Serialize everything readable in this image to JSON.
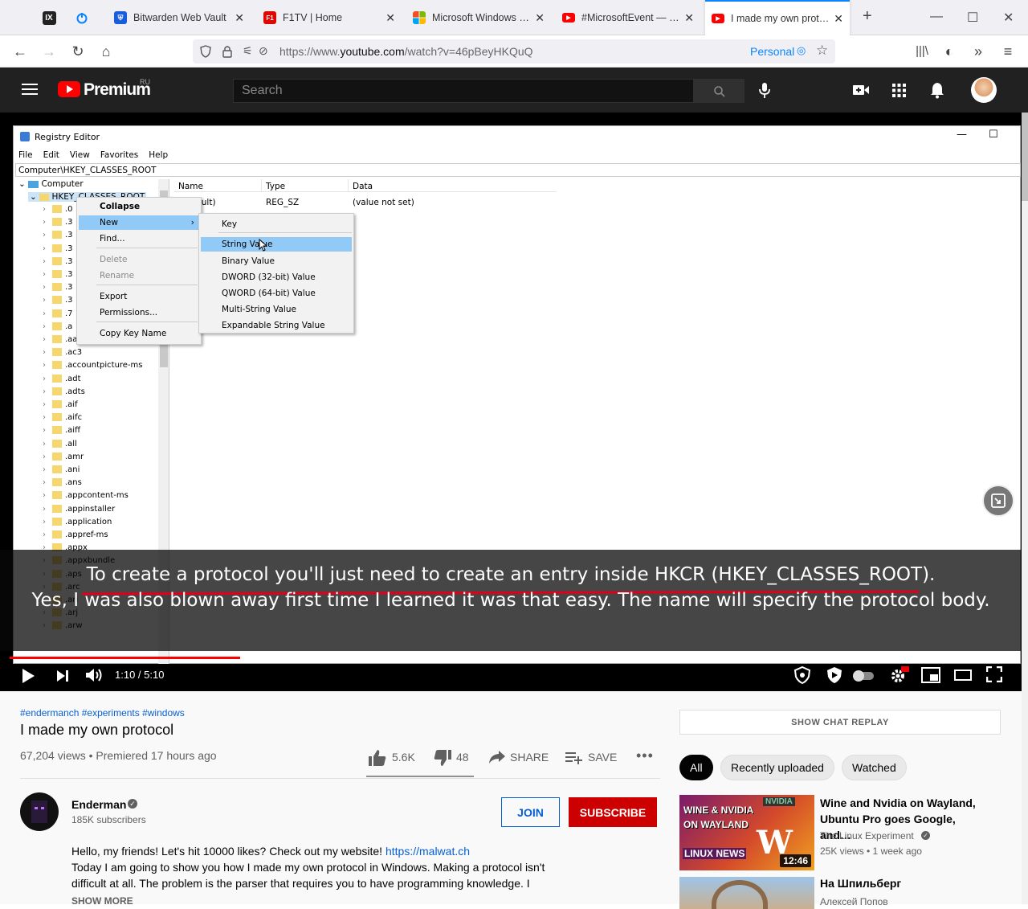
{
  "tabs": [
    {
      "title": "IX",
      "pinned": true
    },
    {
      "title": "",
      "pinned": true
    },
    {
      "title": "Bitwarden Web Vault"
    },
    {
      "title": "F1TV | Home"
    },
    {
      "title": "Microsoft Windows Even"
    },
    {
      "title": "#MicrosoftEvent — прем"
    },
    {
      "title": "I made my own protoco",
      "active": true
    }
  ],
  "url": {
    "prefix": "https://www.",
    "domain": "youtube.com",
    "path": "/watch?v=46pBeyHKQuQ",
    "container": "Personal"
  },
  "youtube": {
    "logo": "Premium",
    "region": "RU",
    "search_placeholder": "Search"
  },
  "regedit": {
    "title": "Registry Editor",
    "menu": [
      "File",
      "Edit",
      "View",
      "Favorites",
      "Help"
    ],
    "path": "Computer\\HKEY_CLASSES_ROOT",
    "tree_root": "Computer",
    "tree_hkey": "HKEY_CLASSES_ROOT",
    "tree_items": [
      ".aac",
      ".ac3",
      ".accountpicture-ms",
      ".adt",
      ".adts",
      ".aif",
      ".aifc",
      ".aiff",
      ".all",
      ".amr",
      ".ani",
      ".ans",
      ".appcontent-ms",
      ".appinstaller",
      ".application",
      ".appref-ms",
      ".appx",
      ".appxbundle",
      ".aps",
      ".arc",
      ".ari",
      ".arj",
      ".arw"
    ],
    "partial_items": [
      ".0",
      ".3",
      ".3",
      ".3",
      ".3",
      ".3",
      ".3",
      ".3",
      ".7",
      ".a"
    ],
    "columns": [
      "Name",
      "Type",
      "Data"
    ],
    "row": {
      "name": "(Default)",
      "type": "REG_SZ",
      "data": "(value not set)"
    },
    "context_menu": [
      "Collapse",
      "New",
      "Find...",
      "Delete",
      "Rename",
      "Export",
      "Permissions...",
      "Copy Key Name"
    ],
    "submenu": [
      "Key",
      "String Value",
      "Binary Value",
      "DWORD (32-bit) Value",
      "QWORD (64-bit) Value",
      "Multi-String Value",
      "Expandable String Value"
    ]
  },
  "captions": [
    "To create a protocol you'll just need to create an entry inside HKCR (HKEY_CLASSES_ROOT).",
    "Yes, I was also blown away first time I learned it was that easy. The name will specify the protocol body."
  ],
  "player": {
    "time": "1:10 / 5:10",
    "progress": 0.23,
    "buffered": 0.48
  },
  "video": {
    "hashtags": "#endermanch #experiments #windows",
    "title": "I made my own protocol",
    "meta": "67,204 views • Premiered 17 hours ago",
    "likes": "5.6K",
    "dislikes": "48",
    "share": "SHARE",
    "save": "SAVE"
  },
  "channel": {
    "name": "Enderman",
    "subs": "185K subscribers",
    "join": "JOIN",
    "subscribe": "SUBSCRIBE"
  },
  "description": {
    "line1": "Hello, my friends! Let's hit 10000 likes? Check out my website! ",
    "link": "https://malwat.ch",
    "line2": "Today I am going to show you how I made my own protocol in Windows. Making a protocol isn't",
    "line3": "difficult at all. The problem is the parser that requires you to have programming knowledge. I",
    "more": "SHOW MORE"
  },
  "sidebar": {
    "chat_replay": "SHOW CHAT REPLAY",
    "chips": [
      "All",
      "Recently uploaded",
      "Watched"
    ],
    "rec1": {
      "title": "Wine and Nvidia on Wayland, Ubuntu Pro goes Google, and…",
      "channel": "The Linux Experiment",
      "meta": "25K views • 1 week ago",
      "duration": "12:46",
      "thumb_top": "WINE & NVIDIA",
      "thumb_mid": "ON WAYLAND",
      "thumb_bottom": "LINUX NEWS",
      "thumb_brand": "NVIDIA"
    },
    "rec2": {
      "title": "На Шпильберг",
      "channel": "Алексей Попов"
    }
  }
}
